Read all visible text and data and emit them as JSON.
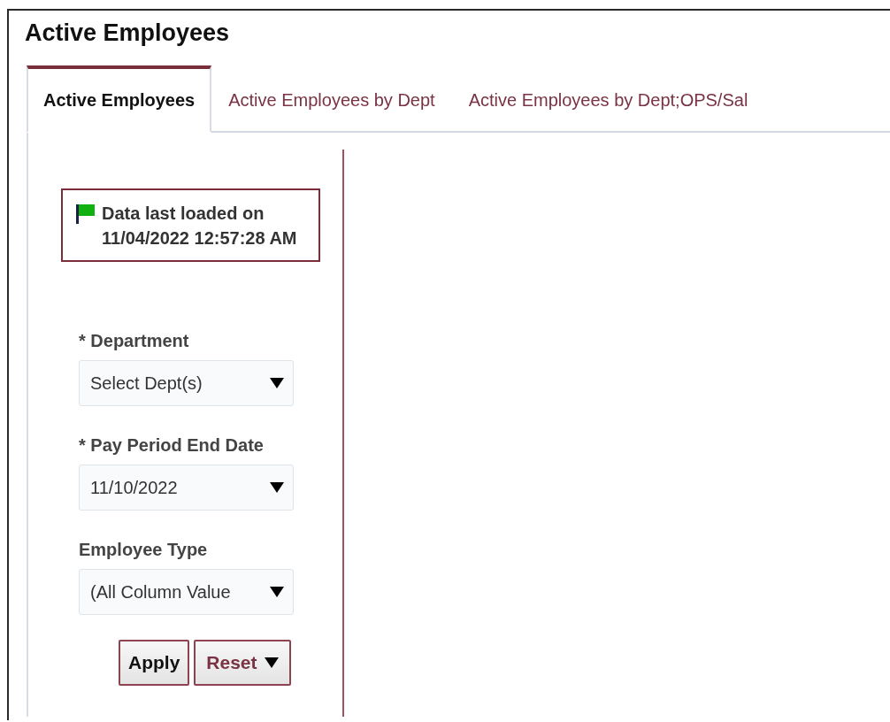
{
  "title": "Active Employees",
  "tabs": [
    {
      "label": "Active Employees",
      "selected": true
    },
    {
      "label": "Active Employees by Dept",
      "selected": false
    },
    {
      "label": "Active Employees by Dept;OPS/Sal",
      "selected": false
    }
  ],
  "status": {
    "text": "Data last loaded on 11/04/2022 12:57:28 AM"
  },
  "filters": [
    {
      "label": "* Department",
      "value": "Select Dept(s)"
    },
    {
      "label": "* Pay Period End Date",
      "value": "11/10/2022"
    },
    {
      "label": "Employee Type",
      "value": "(All Column Value"
    }
  ],
  "buttons": [
    {
      "label": "Apply",
      "kind": "plain"
    },
    {
      "label": "Reset",
      "kind": "menu"
    }
  ]
}
